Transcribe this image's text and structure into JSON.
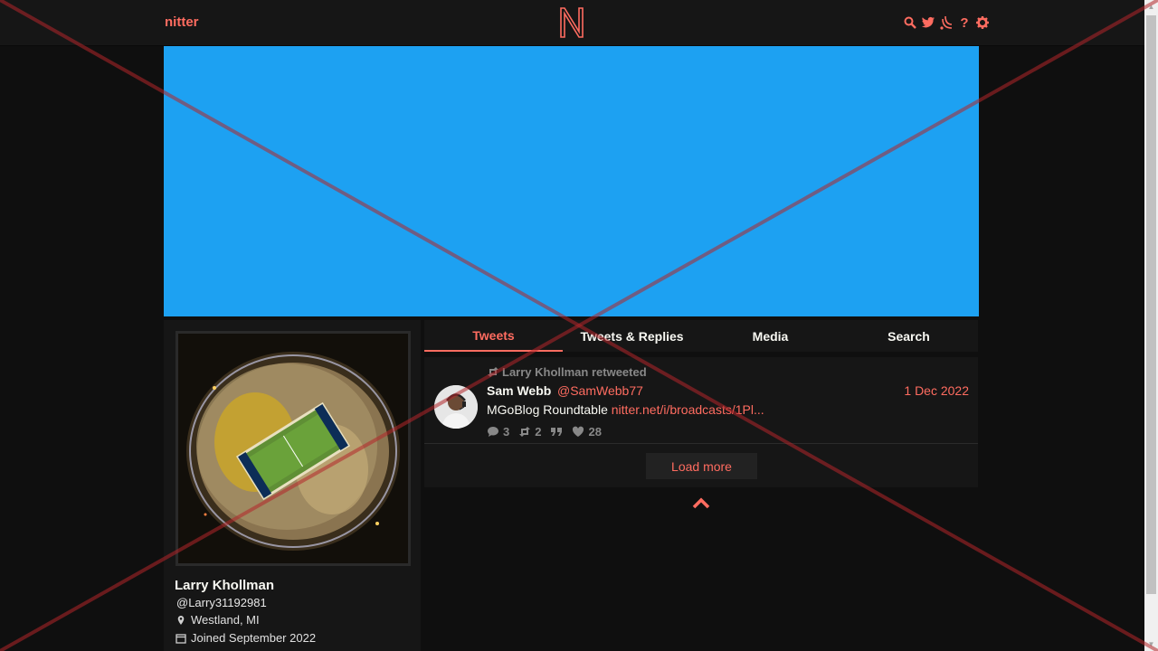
{
  "navbar": {
    "brand": "nitter",
    "logo_icon": "nitter-n-logo-icon",
    "icons": [
      "search-icon",
      "twitter-bird-icon",
      "rss-icon",
      "help-icon",
      "settings-gear-icon"
    ],
    "help_glyph": "?"
  },
  "banner": {
    "color": "#1da1f2"
  },
  "profile": {
    "fullname": "Larry Khollman",
    "username": "@Larry31192981",
    "location": "Westland, MI",
    "joined": "Joined September 2022"
  },
  "tabs": [
    {
      "label": "Tweets",
      "active": true
    },
    {
      "label": "Tweets & Replies",
      "active": false
    },
    {
      "label": "Media",
      "active": false
    },
    {
      "label": "Search",
      "active": false
    }
  ],
  "tweet": {
    "retweet_header": "Larry Khollman retweeted",
    "fullname": "Sam Webb",
    "username": "@SamWebb77",
    "date": "1 Dec 2022",
    "content_text": "MGoBlog Roundtable",
    "content_link": "nitter.net/i/broadcasts/1Pl...",
    "replies": "3",
    "retweets": "2",
    "likes": "28"
  },
  "load_more": "Load more",
  "colors": {
    "accent": "#ff6c60",
    "background": "#0f0f0f",
    "panel": "#161616"
  }
}
